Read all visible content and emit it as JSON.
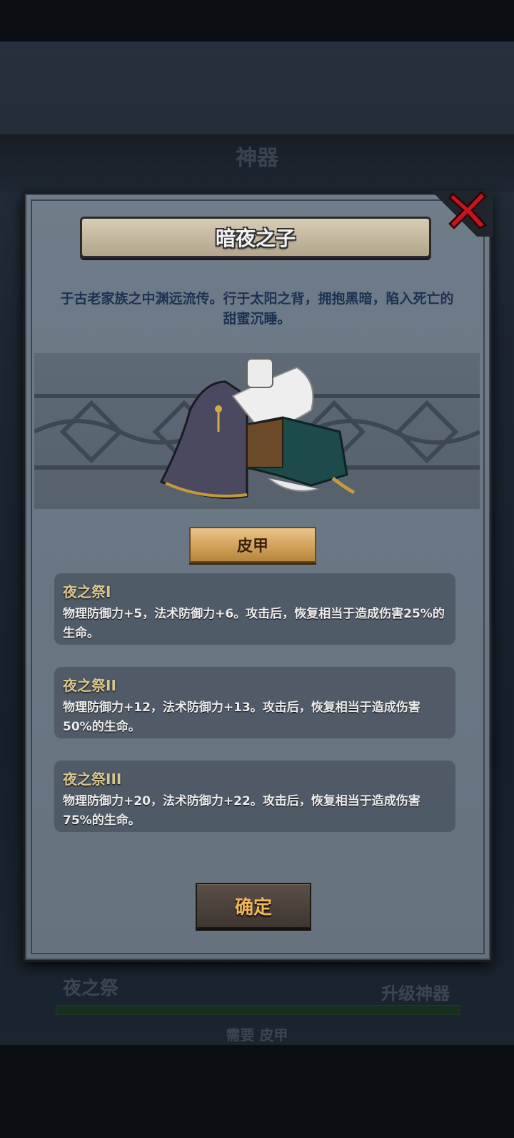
{
  "background": {
    "title": "神器",
    "skill_label": "夜之祭",
    "upgrade_label": "升级神器",
    "requirement": "需要 皮甲"
  },
  "dialog": {
    "title": "暗夜之子",
    "description": "于古老家族之中渊远流传。行于太阳之背，拥抱黑暗，陷入死亡的甜蜜沉睡。",
    "item_type": "皮甲",
    "skills": [
      {
        "name": "夜之祭I",
        "description": "物理防御力+5，法术防御力+6。攻击后，恢复相当于造成伤害25%的生命。"
      },
      {
        "name": "夜之祭II",
        "description": "物理防御力+12，法术防御力+13。攻击后，恢复相当于造成伤害50%的生命。"
      },
      {
        "name": "夜之祭III",
        "description": "物理防御力+20，法术防御力+22。攻击后，恢复相当于造成伤害75%的生命。"
      }
    ],
    "confirm_label": "确定"
  },
  "colors": {
    "title_gold": "#f0b657",
    "skill_name": "#d8c690",
    "description_blue": "#1d3152",
    "close_red": "#c4161c"
  },
  "icons": [
    "close-icon",
    "armor-item-image",
    "skill-icon",
    "upgrade-arrow-icon"
  ]
}
